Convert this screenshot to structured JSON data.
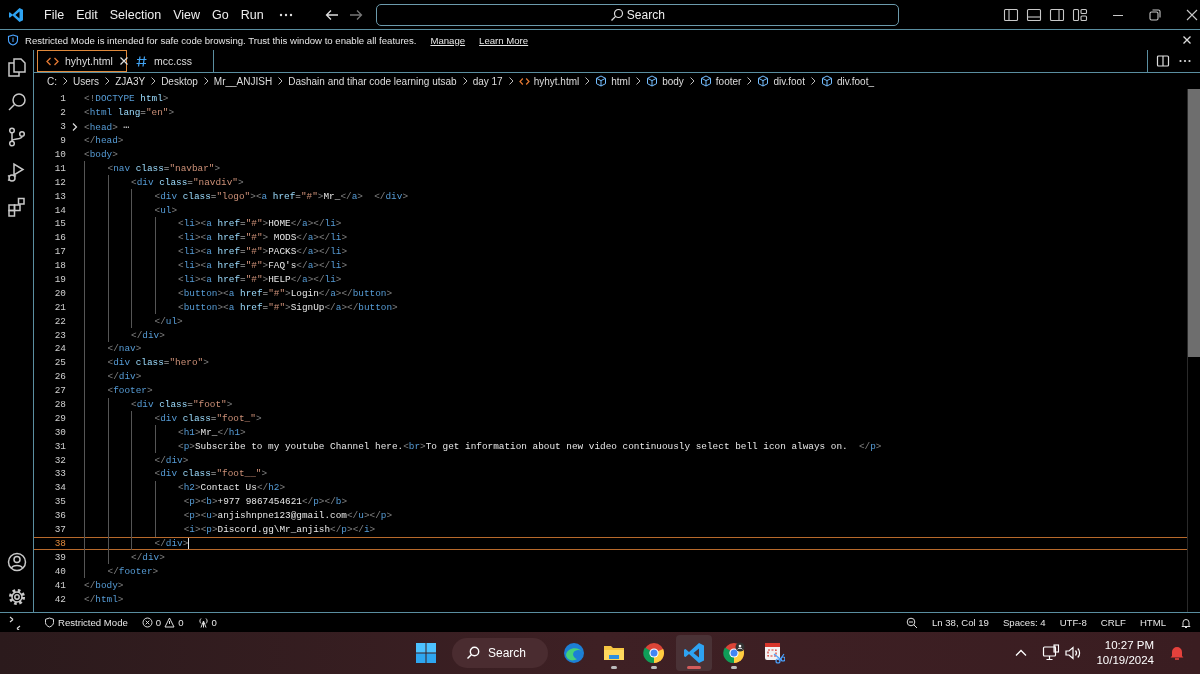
{
  "title_bar": {
    "menu": [
      "File",
      "Edit",
      "Selection",
      "View",
      "Go",
      "Run"
    ],
    "search": {
      "placeholder": "Search"
    }
  },
  "banner": {
    "message": "Restricted Mode is intended for safe code browsing. Trust this window to enable all features.",
    "links": [
      "Manage",
      "Learn More"
    ]
  },
  "tabs": [
    {
      "label": "hyhyt.html",
      "kind": "html",
      "selected": true
    },
    {
      "label": "mcc.css",
      "kind": "css",
      "selected": false
    }
  ],
  "breadcrumbs": [
    {
      "label": "C:",
      "kind": "folder"
    },
    {
      "label": "Users",
      "kind": "folder"
    },
    {
      "label": "ZJA3Y",
      "kind": "folder"
    },
    {
      "label": "Desktop",
      "kind": "folder"
    },
    {
      "label": "Mr__ANJISH",
      "kind": "folder"
    },
    {
      "label": "Dashain and tihar code learning utsab",
      "kind": "folder"
    },
    {
      "label": "day 17",
      "kind": "folder"
    },
    {
      "label": "hyhyt.html",
      "kind": "file"
    },
    {
      "label": "html",
      "kind": "element"
    },
    {
      "label": "body",
      "kind": "element"
    },
    {
      "label": "footer",
      "kind": "element"
    },
    {
      "label": "div.foot",
      "kind": "element"
    },
    {
      "label": "div.foot_",
      "kind": "element"
    }
  ],
  "editor": {
    "lines": [
      {
        "number": "1",
        "current": false,
        "folded": false,
        "tokens": [
          {
            "kind": "tag",
            "text": "<!DOCTYPE"
          },
          {
            "kind": "attr",
            "text": " html"
          },
          {
            "kind": "tag",
            "text": ">"
          }
        ]
      },
      {
        "number": "2",
        "current": false,
        "folded": false,
        "tokens": [
          {
            "kind": "tag",
            "text": "<html"
          },
          {
            "kind": "attr",
            "text": " lang"
          },
          {
            "kind": "punct",
            "text": "="
          },
          {
            "kind": "str",
            "text": "\"en\""
          },
          {
            "kind": "tag",
            "text": ">"
          }
        ]
      },
      {
        "number": "3",
        "current": false,
        "folded": true,
        "tokens": [
          {
            "kind": "tag",
            "text": "<head>"
          },
          {
            "kind": "fold",
            "text": "⋯"
          }
        ]
      },
      {
        "number": "9",
        "current": false,
        "folded": false,
        "tokens": [
          {
            "kind": "tag",
            "text": "</head>"
          }
        ]
      },
      {
        "number": "10",
        "current": false,
        "folded": false,
        "tokens": [
          {
            "kind": "tag",
            "text": "<body>"
          }
        ]
      },
      {
        "number": "11",
        "current": false,
        "folded": false,
        "tokens": [
          {
            "kind": "tag",
            "text": "    <nav"
          },
          {
            "kind": "attr",
            "text": " class"
          },
          {
            "kind": "punct",
            "text": "="
          },
          {
            "kind": "str",
            "text": "\"navbar\""
          },
          {
            "kind": "tag",
            "text": ">"
          }
        ]
      },
      {
        "number": "12",
        "current": false,
        "folded": false,
        "tokens": [
          {
            "kind": "tag",
            "text": "        <div"
          },
          {
            "kind": "attr",
            "text": " class"
          },
          {
            "kind": "punct",
            "text": "="
          },
          {
            "kind": "str",
            "text": "\"navdiv\""
          },
          {
            "kind": "tag",
            "text": ">"
          }
        ]
      },
      {
        "number": "13",
        "current": false,
        "folded": false,
        "tokens": [
          {
            "kind": "tag",
            "text": "            <div"
          },
          {
            "kind": "attr",
            "text": " class"
          },
          {
            "kind": "punct",
            "text": "="
          },
          {
            "kind": "str",
            "text": "\"logo\""
          },
          {
            "kind": "tag",
            "text": "><a"
          },
          {
            "kind": "attr",
            "text": " href"
          },
          {
            "kind": "punct",
            "text": "="
          },
          {
            "kind": "str",
            "text": "\"#\""
          },
          {
            "kind": "tag",
            "text": ">"
          },
          {
            "kind": "text",
            "text": "Mr_"
          },
          {
            "kind": "tag",
            "text": "</a>  </div>"
          }
        ]
      },
      {
        "number": "14",
        "current": false,
        "folded": false,
        "tokens": [
          {
            "kind": "tag",
            "text": "            <ul>"
          }
        ]
      },
      {
        "number": "15",
        "current": false,
        "folded": false,
        "tokens": [
          {
            "kind": "tag",
            "text": "                <li><a"
          },
          {
            "kind": "attr",
            "text": " href"
          },
          {
            "kind": "punct",
            "text": "="
          },
          {
            "kind": "str",
            "text": "\"#\""
          },
          {
            "kind": "tag",
            "text": ">"
          },
          {
            "kind": "text",
            "text": "HOME"
          },
          {
            "kind": "tag",
            "text": "</a></li>"
          }
        ]
      },
      {
        "number": "16",
        "current": false,
        "folded": false,
        "tokens": [
          {
            "kind": "tag",
            "text": "                <li><a"
          },
          {
            "kind": "attr",
            "text": " href"
          },
          {
            "kind": "punct",
            "text": "="
          },
          {
            "kind": "str",
            "text": "\"#\""
          },
          {
            "kind": "tag",
            "text": ">"
          },
          {
            "kind": "text",
            "text": " MODS"
          },
          {
            "kind": "tag",
            "text": "</a></li>"
          }
        ]
      },
      {
        "number": "17",
        "current": false,
        "folded": false,
        "tokens": [
          {
            "kind": "tag",
            "text": "                <li><a"
          },
          {
            "kind": "attr",
            "text": " href"
          },
          {
            "kind": "punct",
            "text": "="
          },
          {
            "kind": "str",
            "text": "\"#\""
          },
          {
            "kind": "tag",
            "text": ">"
          },
          {
            "kind": "text",
            "text": "PACKS"
          },
          {
            "kind": "tag",
            "text": "</a></li>"
          }
        ]
      },
      {
        "number": "18",
        "current": false,
        "folded": false,
        "tokens": [
          {
            "kind": "tag",
            "text": "                <li><a"
          },
          {
            "kind": "attr",
            "text": " href"
          },
          {
            "kind": "punct",
            "text": "="
          },
          {
            "kind": "str",
            "text": "\"#\""
          },
          {
            "kind": "tag",
            "text": ">"
          },
          {
            "kind": "text",
            "text": "FAQ's"
          },
          {
            "kind": "tag",
            "text": "</a></li>"
          }
        ]
      },
      {
        "number": "19",
        "current": false,
        "folded": false,
        "tokens": [
          {
            "kind": "tag",
            "text": "                <li><a"
          },
          {
            "kind": "attr",
            "text": " href"
          },
          {
            "kind": "punct",
            "text": "="
          },
          {
            "kind": "str",
            "text": "\"#\""
          },
          {
            "kind": "tag",
            "text": ">"
          },
          {
            "kind": "text",
            "text": "HELP"
          },
          {
            "kind": "tag",
            "text": "</a></li>"
          }
        ]
      },
      {
        "number": "20",
        "current": false,
        "folded": false,
        "tokens": [
          {
            "kind": "tag",
            "text": "                <button><a"
          },
          {
            "kind": "attr",
            "text": " href"
          },
          {
            "kind": "punct",
            "text": "="
          },
          {
            "kind": "str",
            "text": "\"#\""
          },
          {
            "kind": "tag",
            "text": ">"
          },
          {
            "kind": "text",
            "text": "Login"
          },
          {
            "kind": "tag",
            "text": "</a></button>"
          }
        ]
      },
      {
        "number": "21",
        "current": false,
        "folded": false,
        "tokens": [
          {
            "kind": "tag",
            "text": "                <button><a"
          },
          {
            "kind": "attr",
            "text": " href"
          },
          {
            "kind": "punct",
            "text": "="
          },
          {
            "kind": "str",
            "text": "\"#\""
          },
          {
            "kind": "tag",
            "text": ">"
          },
          {
            "kind": "text",
            "text": "SignUp"
          },
          {
            "kind": "tag",
            "text": "</a></button>"
          }
        ]
      },
      {
        "number": "22",
        "current": false,
        "folded": false,
        "tokens": [
          {
            "kind": "tag",
            "text": "            </ul>"
          }
        ]
      },
      {
        "number": "23",
        "current": false,
        "folded": false,
        "tokens": [
          {
            "kind": "tag",
            "text": "        </div>"
          }
        ]
      },
      {
        "number": "24",
        "current": false,
        "folded": false,
        "tokens": [
          {
            "kind": "tag",
            "text": "    </nav>"
          }
        ]
      },
      {
        "number": "25",
        "current": false,
        "folded": false,
        "tokens": [
          {
            "kind": "tag",
            "text": "    <div"
          },
          {
            "kind": "attr",
            "text": " class"
          },
          {
            "kind": "punct",
            "text": "="
          },
          {
            "kind": "str",
            "text": "\"hero\""
          },
          {
            "kind": "tag",
            "text": ">"
          }
        ]
      },
      {
        "number": "26",
        "current": false,
        "folded": false,
        "tokens": [
          {
            "kind": "tag",
            "text": "    </div>"
          }
        ]
      },
      {
        "number": "27",
        "current": false,
        "folded": false,
        "tokens": [
          {
            "kind": "tag",
            "text": "    <footer>"
          }
        ]
      },
      {
        "number": "28",
        "current": false,
        "folded": false,
        "tokens": [
          {
            "kind": "tag",
            "text": "        <div"
          },
          {
            "kind": "attr",
            "text": " class"
          },
          {
            "kind": "punct",
            "text": "="
          },
          {
            "kind": "str",
            "text": "\"foot\""
          },
          {
            "kind": "tag",
            "text": ">"
          }
        ]
      },
      {
        "number": "29",
        "current": false,
        "folded": false,
        "tokens": [
          {
            "kind": "tag",
            "text": "            <div"
          },
          {
            "kind": "attr",
            "text": " class"
          },
          {
            "kind": "punct",
            "text": "="
          },
          {
            "kind": "str",
            "text": "\"foot_\""
          },
          {
            "kind": "tag",
            "text": ">"
          }
        ]
      },
      {
        "number": "30",
        "current": false,
        "folded": false,
        "tokens": [
          {
            "kind": "tag",
            "text": "                <h1>"
          },
          {
            "kind": "text",
            "text": "Mr_"
          },
          {
            "kind": "tag",
            "text": "</h1>"
          }
        ]
      },
      {
        "number": "31",
        "current": false,
        "folded": false,
        "tokens": [
          {
            "kind": "tag",
            "text": "                <p>"
          },
          {
            "kind": "text",
            "text": "Subscribe to my youtube Channel here."
          },
          {
            "kind": "tag",
            "text": "<br>"
          },
          {
            "kind": "text",
            "text": "To get information about new video continuously select bell icon always on."
          },
          {
            "kind": "tag",
            "text": "  </p>"
          }
        ]
      },
      {
        "number": "32",
        "current": false,
        "folded": false,
        "tokens": [
          {
            "kind": "tag",
            "text": "            </div>"
          }
        ]
      },
      {
        "number": "33",
        "current": false,
        "folded": false,
        "tokens": [
          {
            "kind": "tag",
            "text": "            <div"
          },
          {
            "kind": "attr",
            "text": " class"
          },
          {
            "kind": "punct",
            "text": "="
          },
          {
            "kind": "str",
            "text": "\"foot__\""
          },
          {
            "kind": "tag",
            "text": ">"
          }
        ]
      },
      {
        "number": "34",
        "current": false,
        "folded": false,
        "tokens": [
          {
            "kind": "tag",
            "text": "                <h2>"
          },
          {
            "kind": "text",
            "text": "Contact Us"
          },
          {
            "kind": "tag",
            "text": "</h2>"
          }
        ]
      },
      {
        "number": "35",
        "current": false,
        "folded": false,
        "tokens": [
          {
            "kind": "tag",
            "text": "                 <p><b>"
          },
          {
            "kind": "text",
            "text": "+977 9867454621"
          },
          {
            "kind": "tag",
            "text": "</p></b>"
          }
        ]
      },
      {
        "number": "36",
        "current": false,
        "folded": false,
        "tokens": [
          {
            "kind": "tag",
            "text": "                 <p><u>"
          },
          {
            "kind": "text",
            "text": "anjishnpne123@gmail.com"
          },
          {
            "kind": "tag",
            "text": "</u></p>"
          }
        ]
      },
      {
        "number": "37",
        "current": false,
        "folded": false,
        "tokens": [
          {
            "kind": "tag",
            "text": "                 <i><p>"
          },
          {
            "kind": "text",
            "text": "Discord.gg\\Mr_anjish"
          },
          {
            "kind": "tag",
            "text": "</p></i>"
          }
        ]
      },
      {
        "number": "38",
        "current": true,
        "folded": false,
        "tokens": [
          {
            "kind": "tag",
            "text": "            </div>"
          }
        ]
      },
      {
        "number": "39",
        "current": false,
        "folded": false,
        "tokens": [
          {
            "kind": "tag",
            "text": "        </div>"
          }
        ]
      },
      {
        "number": "40",
        "current": false,
        "folded": false,
        "tokens": [
          {
            "kind": "tag",
            "text": "    </footer>"
          }
        ]
      },
      {
        "number": "41",
        "current": false,
        "folded": false,
        "tokens": [
          {
            "kind": "tag",
            "text": "</body>"
          }
        ]
      },
      {
        "number": "42",
        "current": false,
        "folded": false,
        "tokens": [
          {
            "kind": "tag",
            "text": "</html>"
          }
        ]
      }
    ]
  },
  "status_bar": {
    "mode": "Restricted Mode",
    "errors": "0",
    "warnings": "0",
    "ports": "0",
    "items": [
      "Ln 38, Col 19",
      "Spaces: 4",
      "UTF-8",
      "CRLF",
      "HTML"
    ]
  },
  "taskbar": {
    "search": "Search",
    "apps": [
      {
        "kind": "edge",
        "running": false,
        "active": false
      },
      {
        "kind": "files",
        "running": true,
        "active": false
      },
      {
        "kind": "chrome",
        "running": true,
        "active": false
      },
      {
        "kind": "vscode",
        "running": true,
        "active": true
      },
      {
        "kind": "chrome-profile",
        "running": true,
        "active": false
      },
      {
        "kind": "snipping",
        "running": false,
        "active": false
      }
    ],
    "time": "10:27 PM",
    "date": "10/19/2024"
  }
}
